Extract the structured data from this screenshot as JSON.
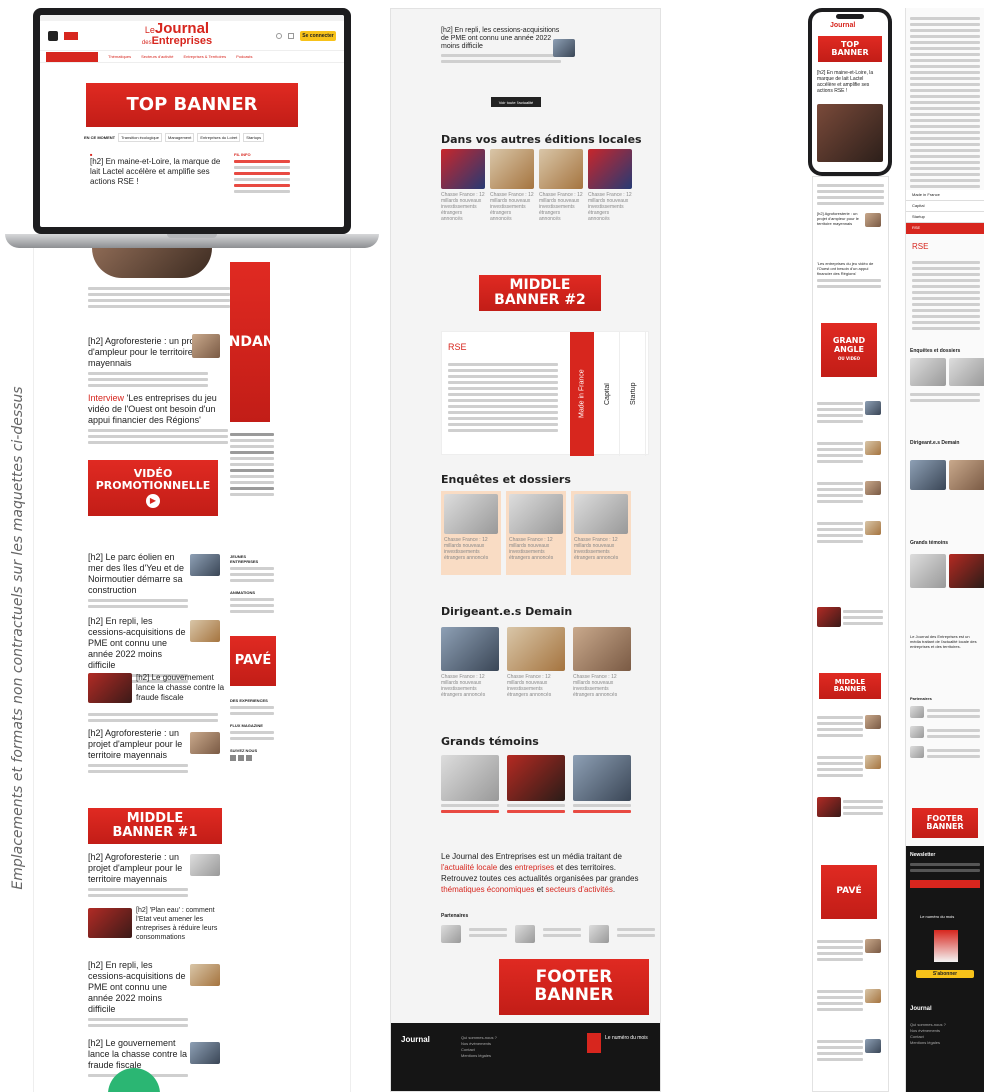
{
  "side_note": "Emplacements et formats non contractuels sur les maquettes ci-dessus",
  "brand": {
    "name_top": "Le",
    "name_main": "Journal",
    "name_sub": "des",
    "name_sub2": "Entreprises"
  },
  "colors": {
    "accent": "#d7261e",
    "yellow": "#f7c21a",
    "teal": "#2bb673",
    "dark": "#151515"
  },
  "laptop": {
    "subscribe_label": "Se connecter",
    "nav": [
      "Thématiques",
      "Secteurs d'activité",
      "Entreprises & Territoires",
      "Podcasts"
    ],
    "top_banner": "TOP BANNER",
    "en_ce_moment": "EN CE MOMENT",
    "chips": [
      "Transition écologique",
      "Management",
      "Entreprises du Loiret",
      "Startups"
    ],
    "lead_title": "[h2] En maine-et-Loire, la marque de lait Lactel accélère et amplifie ses actions RSE !",
    "flash_label": "FIL INFO"
  },
  "col1": {
    "grand_angle": [
      "GRAND",
      "ANGLE"
    ],
    "articles": [
      "[h2] Agroforesterie : un projet d'ampleur pour le territoire mayennais",
      "Interview",
      "'Les entreprises du jeu vidéo de l'Ouest ont besoin d'un appui financier des Régions'",
      "[h2] Le parc éolien en mer des îles d'Yeu et de Noirmoutier démarre sa construction",
      "[h2] En repli, les cessions-acquisitions de PME ont connu une année 2022 moins difficile",
      "[h2] Le gouvernement lance la chasse contre la fraude fiscale",
      "[h2] Agroforesterie : un projet d'ampleur pour le territoire mayennais",
      "[h2] 'Plan eau' : comment l'Etat veut amener les entreprises à réduire leurs consommations",
      "[h2] En repli, les cessions-acquisitions de PME ont connu une année 2022 moins difficile",
      "[h2] Le gouvernement lance la chasse contre la fraude fiscale"
    ],
    "video": [
      "VIDÉO",
      "PROMOTIONNELLE"
    ],
    "pave": "PAVÉ",
    "middle1": [
      "MIDDLE",
      "BANNER #1"
    ],
    "side_titles": [
      "JEUNES ENTREPRISES",
      "ANIMATIONS",
      "DES EXPERIENCES",
      "FLUX MAGAZINE"
    ],
    "suivez": "SUIVEZ NOUS"
  },
  "col2": {
    "top_lines": "[h2] En repli, les cessions-acquisitions de PME ont connu une année 2022 moins difficile",
    "voir_plus": "Voir toute l'actualité",
    "sections": {
      "autres_editions": "Dans vos autres éditions locales",
      "middle2": [
        "MIDDLE",
        "BANNER #2"
      ],
      "rse": "RSE",
      "vertical_tabs": [
        "Made in France",
        "Capital",
        "Startup"
      ],
      "enquetes": "Enquêtes et dossiers",
      "dirigeants": "Dirigeant.e.s Demain",
      "temoins": "Grands témoins",
      "partenaires": "Partenaires",
      "footer_banner": [
        "FOOTER",
        "BANNER"
      ]
    },
    "card_title": "Chasse France : 12 millards nouveaux investissements étrangers annoncés",
    "tagline_parts": [
      "Le Journal des Entreprises est un média traitant de ",
      "l'actualité locale",
      " des ",
      "entreprises",
      " et des territoires. Retrouvez toutes ces actualités organisées par grandes ",
      "thématiques économiques",
      " et ",
      "secteurs d'activités",
      "."
    ],
    "footer": {
      "magazine": "Le numéro du mois",
      "links": [
        "Qui sommes-nous ?",
        "Nos événements",
        "Contact",
        "Mentions légales"
      ]
    }
  },
  "col3": {
    "top_banner": [
      "TOP",
      "BANNER"
    ],
    "lead_title": "[h2] En maine-et-Loire, la marque de lait Lactel accélère et amplifie ses actions RSE !",
    "grand_angle": [
      "GRAND",
      "ANGLE",
      "OU VIDEO"
    ],
    "middle": [
      "MIDDLE",
      "BANNER"
    ],
    "pave": "PAVÉ"
  },
  "col4": {
    "menu": [
      "Made in France",
      "Capital",
      "Startup",
      "RSE"
    ],
    "rse": "RSE",
    "enquetes": "Enquêtes et dossiers",
    "dirigeants": "Dirigeant.e.s Demain",
    "temoins": "Grands témoins",
    "tagline": "Le Journal des Entreprises est un média traitant de l'actualité locale des entreprises et des territoires.",
    "partenaires": "Partenaires",
    "footer_banner": [
      "FOOTER",
      "BANNER"
    ],
    "newsletter": "Newsletter",
    "magazine": "Le numéro du mois",
    "subscribe": "S'abonner"
  }
}
